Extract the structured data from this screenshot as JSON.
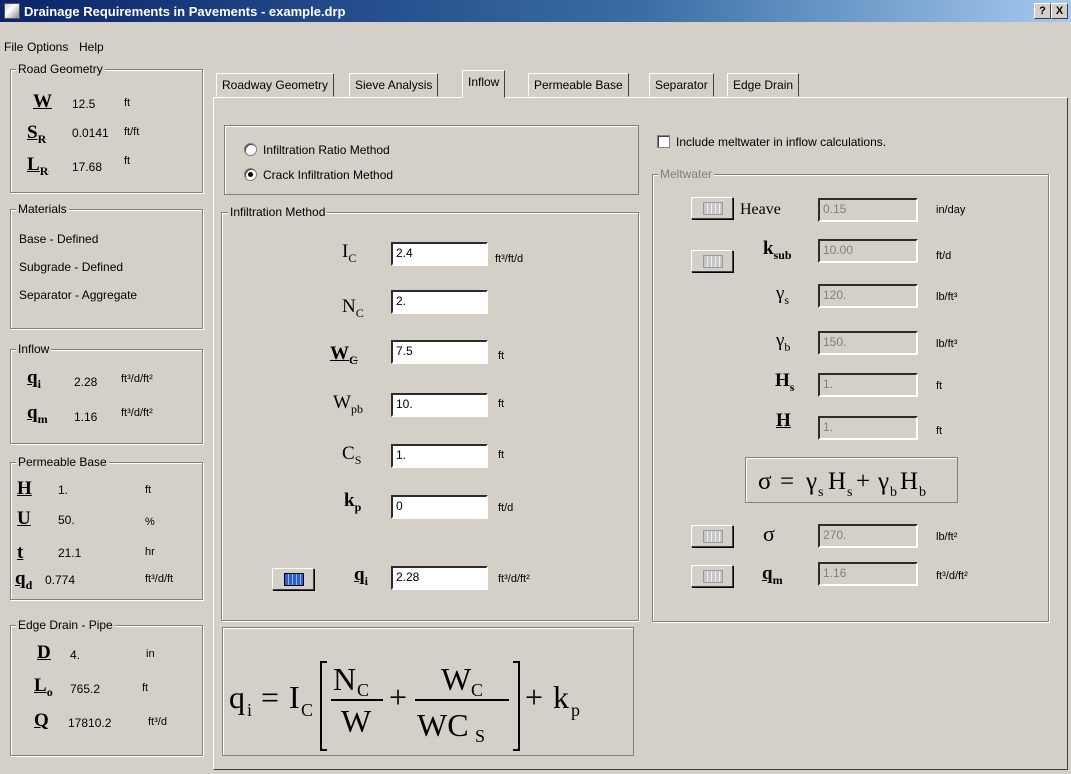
{
  "window": {
    "title": "Drainage Requirements in Pavements - example.drp",
    "help_btn": "?",
    "close_btn": "X"
  },
  "menu": [
    "File",
    "Options",
    "Help"
  ],
  "sidebar": {
    "road_geometry": {
      "label": "Road Geometry",
      "items": [
        {
          "sym": "W",
          "sub": "",
          "value": "12.5",
          "unit": "ft"
        },
        {
          "sym": "S",
          "sub": "R",
          "value": "0.0141",
          "unit": "ft/ft"
        },
        {
          "sym": "L",
          "sub": "R",
          "value": "17.68",
          "unit": "ft"
        }
      ]
    },
    "materials": {
      "label": "Materials",
      "items": [
        "Base - Defined",
        "Subgrade - Defined",
        "Separator - Aggregate"
      ]
    },
    "inflow": {
      "label": "Inflow",
      "items": [
        {
          "sym": "q",
          "sub": "i",
          "value": "2.28",
          "unit": "ft³/d/ft²"
        },
        {
          "sym": "q",
          "sub": "m",
          "value": "1.16",
          "unit": "ft³/d/ft²"
        }
      ]
    },
    "permeable_base": {
      "label": "Permeable Base",
      "items": [
        {
          "sym": "H",
          "sub": "",
          "value": "1.",
          "unit": "ft"
        },
        {
          "sym": "U",
          "sub": "",
          "value": "50.",
          "unit": "%"
        },
        {
          "sym": "t",
          "sub": "",
          "value": "21.1",
          "unit": "hr"
        },
        {
          "sym": "q",
          "sub": "d",
          "value": "0.774",
          "unit": "ft³/d/ft"
        }
      ]
    },
    "edge_drain": {
      "label": "Edge Drain - Pipe",
      "items": [
        {
          "sym": "D",
          "sub": "",
          "value": "4.",
          "unit": "in"
        },
        {
          "sym": "L",
          "sub": "o",
          "value": "765.2",
          "unit": "ft"
        },
        {
          "sym": "Q",
          "sub": "",
          "value": "17810.2",
          "unit": "ft³/d"
        }
      ]
    }
  },
  "tabs": [
    "Roadway Geometry",
    "Sieve Analysis",
    "Inflow",
    "Permeable Base",
    "Separator",
    "Edge Drain"
  ],
  "active_tab": "Inflow",
  "method": {
    "options": [
      "Infiltration Ratio Method",
      "Crack Infiltration Method"
    ],
    "selected": "Crack Infiltration Method"
  },
  "infiltration": {
    "label": "Infiltration Method",
    "fields": [
      {
        "sym": "I",
        "sub": "C",
        "value": "2.4",
        "unit": "ft³/ft/d"
      },
      {
        "sym": "N",
        "sub": "C",
        "value": "2.",
        "unit": ""
      },
      {
        "sym": "W",
        "sub": "C",
        "value": "7.5",
        "unit": "ft"
      },
      {
        "sym": "W",
        "sub": "pb",
        "value": "10.",
        "unit": "ft"
      },
      {
        "sym": "C",
        "sub": "S",
        "value": "1.",
        "unit": "ft"
      },
      {
        "sym": "k",
        "sub": "p",
        "value": "0",
        "unit": "ft/d"
      },
      {
        "sym": "q",
        "sub": "i",
        "value": "2.28",
        "unit": "ft³/d/ft²"
      }
    ]
  },
  "meltwater": {
    "checkbox_label": "Include meltwater in inflow calculations.",
    "checked": false,
    "label": "Meltwater",
    "fields": [
      {
        "sym": "Heave",
        "sub": "",
        "value": "0.15",
        "unit": "in/day"
      },
      {
        "sym": "k",
        "sub": "sub",
        "value": "10.00",
        "unit": "ft/d"
      },
      {
        "sym": "γ",
        "sub": "s",
        "value": "120.",
        "unit": "lb/ft³"
      },
      {
        "sym": "γ",
        "sub": "b",
        "value": "150.",
        "unit": "lb/ft³"
      },
      {
        "sym": "H",
        "sub": "s",
        "value": "1.",
        "unit": "ft"
      },
      {
        "sym": "H",
        "sub": "",
        "value": "1.",
        "unit": "ft"
      },
      {
        "sym": "σ",
        "sub": "",
        "value": "270.",
        "unit": "lb/ft²"
      },
      {
        "sym": "q",
        "sub": "m",
        "value": "1.16",
        "unit": "ft³/d/ft²"
      }
    ]
  }
}
